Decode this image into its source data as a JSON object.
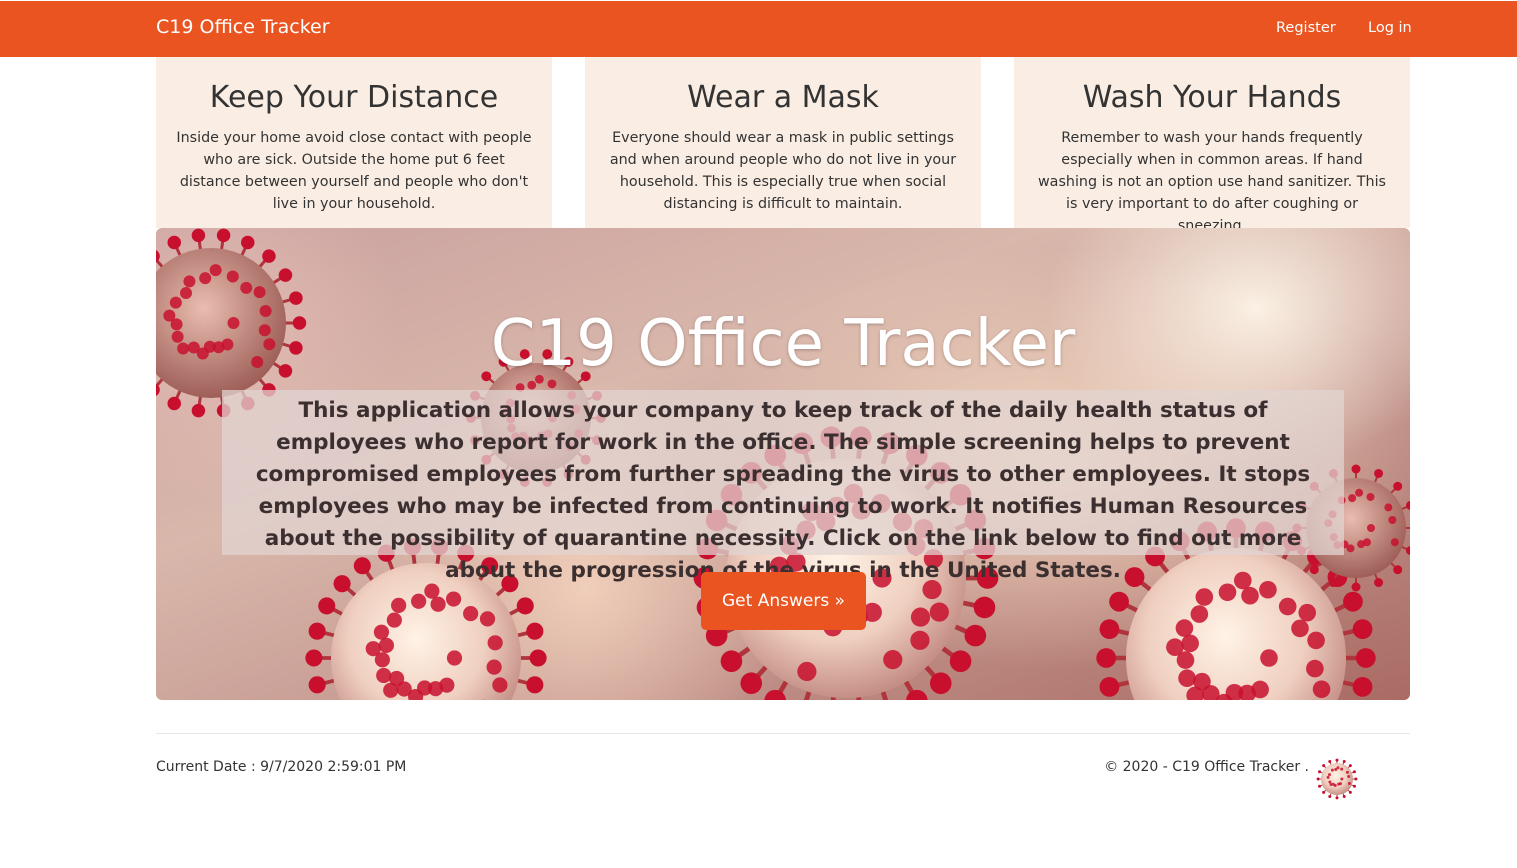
{
  "navbar": {
    "brand": "C19 Office Tracker",
    "register": "Register",
    "login": "Log in"
  },
  "cards": [
    {
      "title": "Keep Your Distance",
      "text": "Inside your home avoid close contact with people who are sick. Outside the home put 6 feet distance between yourself and people who don't live in your household."
    },
    {
      "title": "Wear a Mask",
      "text": "Everyone should wear a mask in public settings and when around people who do not live in your household. This is especially true when social distancing is difficult to maintain."
    },
    {
      "title": "Wash Your Hands",
      "text": "Remember to wash your hands frequently especially when in common areas. If hand washing is not an option use hand sanitizer. This is very important to do after coughing or sneezing."
    }
  ],
  "hero": {
    "title": "C19 Office Tracker",
    "description": "This application allows your company to keep track of the daily health status of employees who report for work in the office. The simple screening helps to prevent compromised employees from further spreading the virus to other employees. It stops employees who may be infected from continuing to work. It notifies Human Resources about the possibility of quarantine necessity. Click on the link below to find out more about the progression of the virus in the United States.",
    "button": "Get Answers »"
  },
  "footer": {
    "current_date": "Current Date : 9/7/2020 2:59:01 PM",
    "copyright": "© 2020 - C19 Office Tracker ."
  },
  "colors": {
    "brand": "#e95420",
    "card_background": "#faeee4",
    "virus_red": "#c8102e"
  },
  "icons": {
    "footer_logo": "coronavirus-icon",
    "hero_background": "coronavirus-particles-illustration"
  }
}
